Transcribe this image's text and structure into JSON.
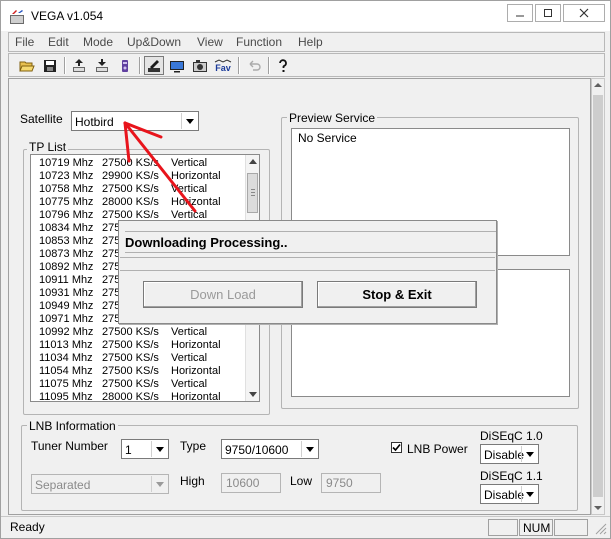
{
  "window": {
    "title": "VEGA v1.054",
    "icon": "vega-app-icon"
  },
  "menu": [
    "File",
    "Edit",
    "Mode",
    "Up&Down",
    "View",
    "Function",
    "Help"
  ],
  "toolbar": {
    "icons": [
      "open-folder-icon",
      "save-disk-icon",
      "upload-icon",
      "download-icon",
      "device-icon",
      "edit-tp-icon",
      "screen-icon",
      "camera-icon",
      "fav-icon",
      "undo-icon",
      "help-icon"
    ],
    "fav_text": "Fav"
  },
  "satellite": {
    "label": "Satellite",
    "value": "Hotbird"
  },
  "tp_list": {
    "title": "TP List",
    "rows": [
      {
        "freq": "10719 Mhz",
        "sym": "27500 KS/s",
        "pol": "Vertical"
      },
      {
        "freq": "10723 Mhz",
        "sym": "29900 KS/s",
        "pol": "Horizontal"
      },
      {
        "freq": "10758 Mhz",
        "sym": "27500 KS/s",
        "pol": "Vertical"
      },
      {
        "freq": "10775 Mhz",
        "sym": "28000 KS/s",
        "pol": "Horizontal"
      },
      {
        "freq": "10796 Mhz",
        "sym": "27500 KS/s",
        "pol": "Vertical"
      },
      {
        "freq": "10834 Mhz",
        "sym": "275",
        "pol": ""
      },
      {
        "freq": "10853 Mhz",
        "sym": "275",
        "pol": ""
      },
      {
        "freq": "10873 Mhz",
        "sym": "275",
        "pol": ""
      },
      {
        "freq": "10892 Mhz",
        "sym": "275",
        "pol": ""
      },
      {
        "freq": "10911 Mhz",
        "sym": "275",
        "pol": ""
      },
      {
        "freq": "10931 Mhz",
        "sym": "275",
        "pol": ""
      },
      {
        "freq": "10949 Mhz",
        "sym": "275",
        "pol": ""
      },
      {
        "freq": "10971 Mhz",
        "sym": "275",
        "pol": ""
      },
      {
        "freq": "10992 Mhz",
        "sym": "27500 KS/s",
        "pol": "Vertical"
      },
      {
        "freq": "11013 Mhz",
        "sym": "27500 KS/s",
        "pol": "Horizontal"
      },
      {
        "freq": "11034 Mhz",
        "sym": "27500 KS/s",
        "pol": "Vertical"
      },
      {
        "freq": "11054 Mhz",
        "sym": "27500 KS/s",
        "pol": "Horizontal"
      },
      {
        "freq": "11075 Mhz",
        "sym": "27500 KS/s",
        "pol": "Vertical"
      },
      {
        "freq": "11095 Mhz",
        "sym": "28000 KS/s",
        "pol": "Horizontal"
      }
    ]
  },
  "preview": {
    "title": "Preview Service",
    "text": "No Service"
  },
  "dialog": {
    "title": "Downloading Processing..",
    "download_label": "Down Load",
    "stop_label": "Stop & Exit"
  },
  "lnb": {
    "title": "LNB Information",
    "tuner_label": "Tuner Number",
    "tuner_value": "1",
    "type_label": "Type",
    "type_value": "9750/10600",
    "power_label": "LNB Power",
    "power_checked": true,
    "mode_value": "Separated",
    "high_label": "High",
    "high_value": "10600",
    "low_label": "Low",
    "low_value": "9750",
    "diseqc10_label": "DiSEqC 1.0",
    "diseqc10_value": "Disable",
    "diseqc11_label": "DiSEqC 1.1",
    "diseqc11_value": "Disable"
  },
  "status": {
    "text": "Ready",
    "num": "NUM"
  },
  "colors": {
    "annotation_arrow": "#e8141c"
  }
}
